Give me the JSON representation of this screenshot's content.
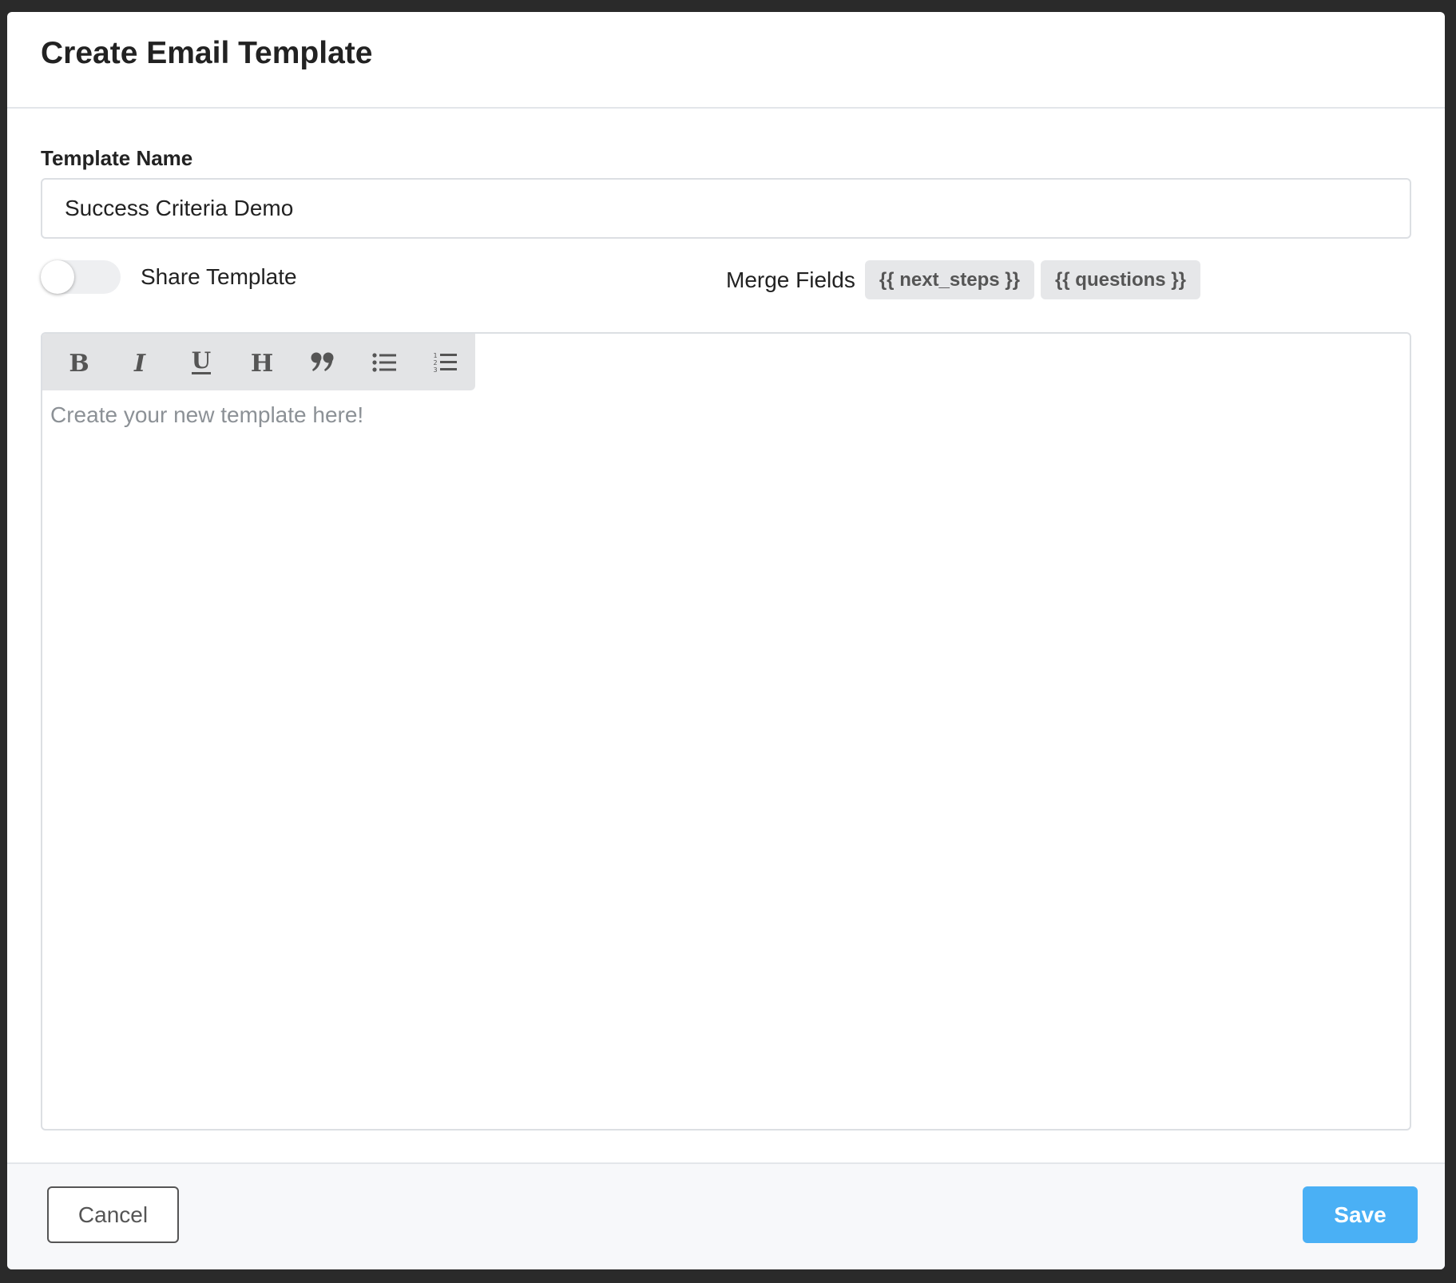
{
  "modal": {
    "title": "Create Email Template"
  },
  "form": {
    "template_name_label": "Template Name",
    "template_name_value": "Success Criteria Demo",
    "share_label": "Share Template",
    "share_enabled": false
  },
  "merge_fields": {
    "label": "Merge Fields",
    "chips": [
      "{{ next_steps }}",
      "{{ questions }}"
    ]
  },
  "editor": {
    "placeholder": "Create your new template here!",
    "toolbar": [
      {
        "name": "bold-icon",
        "label": "Bold"
      },
      {
        "name": "italic-icon",
        "label": "Italic"
      },
      {
        "name": "underline-icon",
        "label": "Underline"
      },
      {
        "name": "heading-icon",
        "label": "Heading"
      },
      {
        "name": "quote-icon",
        "label": "Quote"
      },
      {
        "name": "bullet-list-icon",
        "label": "Bulleted list"
      },
      {
        "name": "numbered-list-icon",
        "label": "Numbered list"
      }
    ]
  },
  "footer": {
    "cancel_label": "Cancel",
    "save_label": "Save"
  },
  "colors": {
    "primary": "#4ab0f5",
    "toolbar_bg": "#e3e4e6",
    "chip_bg": "#e6e7e9",
    "text": "#222222",
    "placeholder": "#8c9196"
  }
}
